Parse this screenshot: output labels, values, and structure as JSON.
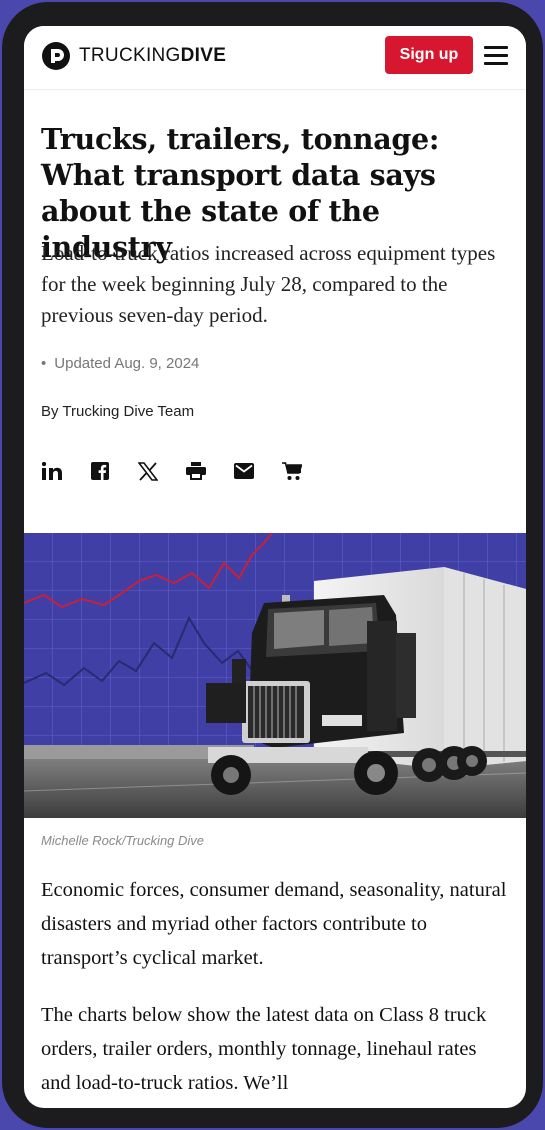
{
  "header": {
    "logo_text_1": "TRUCKING",
    "logo_text_2": "DIVE",
    "signup_label": "Sign up"
  },
  "article": {
    "title": "Trucks, trailers, tonnage: What transport data says about the state of the industry",
    "dek": "Load-to-truck ratios increased across equipment types for the week beginning July 28, compared to the previous seven-day period.",
    "updated": "Updated Aug. 9, 2024",
    "byline": "By Trucking Dive Team",
    "share_icons": [
      "linkedin-icon",
      "facebook-icon",
      "x-icon",
      "print-icon",
      "email-icon",
      "cart-icon"
    ],
    "image_caption": "Michelle Rock/Trucking Dive",
    "paragraphs": [
      "Economic forces, consumer demand, seasonality, natural disasters and myriad other factors contribute to transport’s cyclical market.",
      "The charts below show the latest data on Class 8 truck orders, trailer orders, monthly tonnage, linehaul rates and load-to-truck ratios. We’ll"
    ]
  },
  "colors": {
    "accent": "#d7172f",
    "hero_background": "#3f3fa6",
    "frame": "#1c1c1e"
  }
}
